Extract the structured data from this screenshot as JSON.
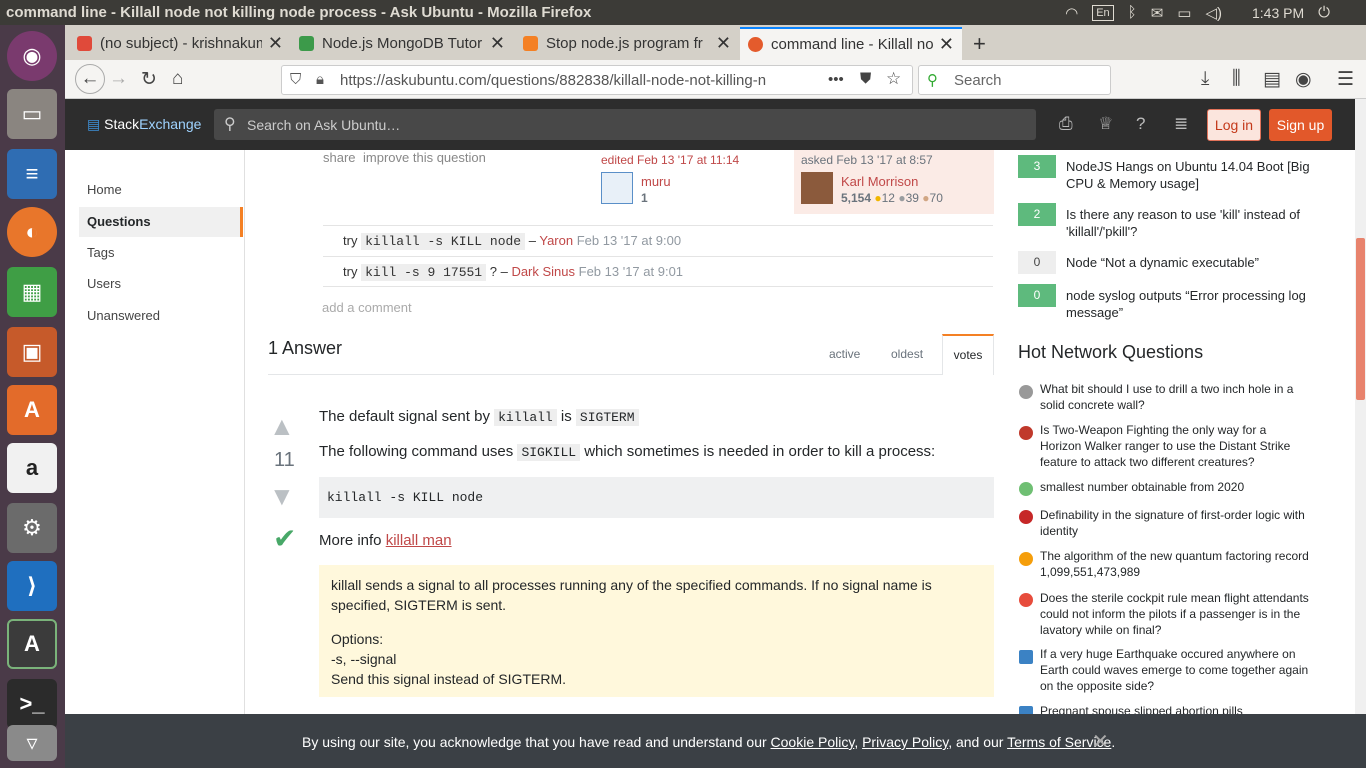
{
  "os": {
    "window_title": "command line - Killall node not killing node process - Ask Ubuntu - Mozilla Firefox",
    "keyboard": "En",
    "time": "1:43 PM"
  },
  "launcher": [
    "Ubuntu",
    "Files",
    "Writer",
    "Firefox",
    "Calc",
    "Impress",
    "Software",
    "Amazon",
    "Settings",
    "VS Code",
    "Updater",
    "Terminal",
    "Trash"
  ],
  "tabs": [
    {
      "label": "(no subject) - krishnakum",
      "close": "✕"
    },
    {
      "label": "Node.js MongoDB Tutor",
      "close": "✕"
    },
    {
      "label": "Stop node.js program fr",
      "close": "✕"
    },
    {
      "label": "command line - Killall no",
      "close": "✕"
    }
  ],
  "new_tab": "+",
  "nav": {
    "url": "https://askubuntu.com/questions/882838/killall-node-not-killing-n",
    "url_host_bold": "askubuntu.com",
    "search_placeholder": "Search",
    "more": "•••"
  },
  "header": {
    "logo_left": "Stack",
    "logo_right": "Exchange",
    "search_placeholder": "Search on Ask Ubuntu…",
    "login": "Log in",
    "signup": "Sign up"
  },
  "left_nav": [
    "Home",
    "Questions",
    "Tags",
    "Users",
    "Unanswered"
  ],
  "question": {
    "share": "share",
    "improve": "improve this question",
    "edited": "edited Feb 13 '17 at 11:14",
    "editor_name": "muru",
    "editor_rep": "1",
    "asked": "asked Feb 13 '17 at 8:57",
    "asker_name": "Karl Morrison",
    "asker_rep": "5,154",
    "gold": "12",
    "silver": "39",
    "bronze": "70"
  },
  "comments": [
    {
      "pre": "try",
      "code": "killall -s KILL node",
      "mid": "–",
      "user": "Yaron",
      "date": "Feb 13 '17 at 9:00"
    },
    {
      "pre": "try",
      "code": "kill -s 9 17551",
      "mid": "? –",
      "user": "Dark Sinus",
      "date": "Feb 13 '17 at 9:01"
    }
  ],
  "add_comment": "add a comment",
  "answers": {
    "count_label": "1 Answer",
    "sort_tabs": [
      "active",
      "oldest",
      "votes"
    ],
    "votes": "11",
    "p1_before": "The default signal sent by",
    "p1_code1": "killall",
    "p1_mid": "is",
    "p1_code2": "SIGTERM",
    "p2_before": "The following command uses",
    "p2_code": "SIGKILL",
    "p2_after": "which sometimes is needed in order to kill a process:",
    "code_block": "killall -s KILL node",
    "more_info": "More info",
    "more_link": "killall man",
    "quote_1": "killall sends a signal to all processes running any of the specified commands. If no signal name is specified, SIGTERM is sent.",
    "quote_2": "Options:",
    "quote_3": "-s, --signal",
    "quote_4": "Send this signal instead of SIGTERM."
  },
  "related": [
    {
      "votes": "3",
      "title": "NodeJS Hangs on Ubuntu 14.04 Boot [Big CPU & Memory usage]"
    },
    {
      "votes": "2",
      "title": "Is there any reason to use 'kill' instead of 'killall'/'pkill'?"
    },
    {
      "votes": "0",
      "title": "Node “Not a dynamic executable”"
    },
    {
      "votes": "0",
      "title": "node syslog outputs “Error processing log message”"
    }
  ],
  "hot_title": "Hot Network Questions",
  "hot": [
    {
      "title": "What bit should I use to drill a two inch hole in a solid concrete wall?",
      "color": "#999999"
    },
    {
      "title": "Is Two-Weapon Fighting the only way for a Horizon Walker ranger to use the Distant Strike feature to attack two different creatures?",
      "color": "#c0392b"
    },
    {
      "title": "smallest number obtainable from 2020",
      "color": "#6fbf73"
    },
    {
      "title": "Definability in the signature of first-order logic with identity",
      "color": "#c62828"
    },
    {
      "title": "The algorithm of the new quantum factoring record 1,099,551,473,989",
      "color": "#f59e0b"
    },
    {
      "title": "Does the sterile cockpit rule mean flight attendants could not inform the pilots if a passenger is in the lavatory while on final?",
      "color": "#e74c3c"
    },
    {
      "title": "If a very huge Earthquake occured anywhere on Earth could waves emerge to come together again on the opposite side?",
      "color": "#3b82c4"
    },
    {
      "title": "Pregnant spouse slipped abortion pills",
      "color": "#3b82c4"
    }
  ],
  "cookie": {
    "text1": "By using our site, you acknowledge that you have read and understand our",
    "link1": "Cookie Policy",
    "sep1": ",",
    "link2": "Privacy Policy",
    "text2": ", and our",
    "link3": "Terms of Service",
    "end": ".",
    "close": "✕"
  }
}
